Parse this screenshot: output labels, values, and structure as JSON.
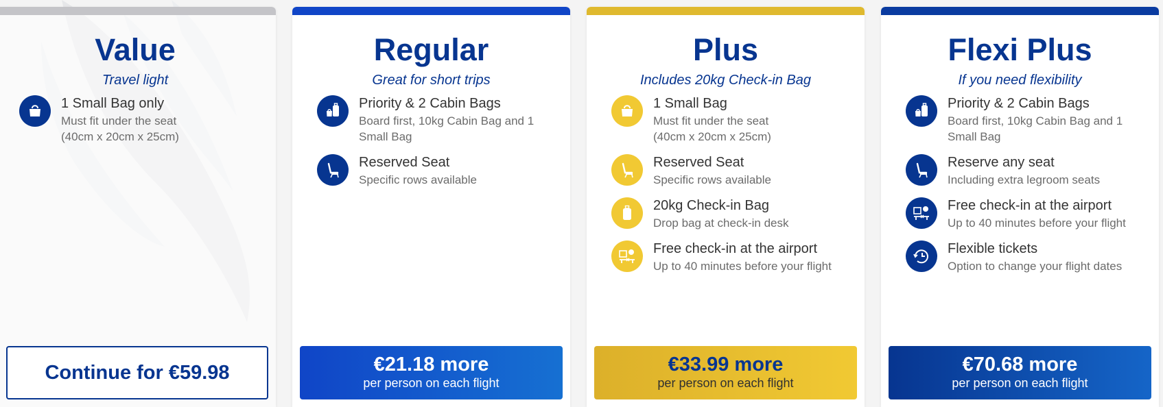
{
  "colors": {
    "brand_navy": "#073590",
    "brand_blue": "#1045c7",
    "brand_yellow": "#f1c933",
    "value_bar": "#c4c4c8",
    "flexi_bar": "#0a3ba0"
  },
  "cards": [
    {
      "title": "Value",
      "subtitle": "Travel light",
      "features": [
        {
          "icon": "small-bag-icon",
          "title": "1 Small Bag only",
          "desc": "Must fit under the seat (40cm x 20cm x 25cm)"
        }
      ],
      "cta": {
        "label": "Continue for €59.98"
      }
    },
    {
      "title": "Regular",
      "subtitle": "Great for short trips",
      "features": [
        {
          "icon": "cabin-bags-icon",
          "title": "Priority & 2 Cabin Bags",
          "desc": "Board first, 10kg Cabin Bag and 1 Small Bag"
        },
        {
          "icon": "seat-icon",
          "title": "Reserved Seat",
          "desc": "Specific rows available"
        }
      ],
      "cta": {
        "price": "€21.18 more",
        "per": "per person on each flight"
      }
    },
    {
      "title": "Plus",
      "subtitle": "Includes 20kg Check-in Bag",
      "features": [
        {
          "icon": "small-bag-icon",
          "title": "1 Small Bag",
          "desc": "Must fit under the seat (40cm x 20cm x 25cm)"
        },
        {
          "icon": "seat-icon",
          "title": "Reserved Seat",
          "desc": "Specific rows available"
        },
        {
          "icon": "suitcase-icon",
          "title": "20kg Check-in Bag",
          "desc": "Drop bag at check-in desk"
        },
        {
          "icon": "checkin-desk-icon",
          "title": "Free check-in at the airport",
          "desc": "Up to 40 minutes before your flight"
        }
      ],
      "cta": {
        "price": "€33.99 more",
        "per": "per person on each flight"
      }
    },
    {
      "title": "Flexi Plus",
      "subtitle": "If you need flexibility",
      "features": [
        {
          "icon": "cabin-bags-icon",
          "title": "Priority & 2 Cabin Bags",
          "desc": "Board first, 10kg Cabin Bag and 1 Small Bag"
        },
        {
          "icon": "seat-icon",
          "title": "Reserve any seat",
          "desc": "Including extra legroom seats"
        },
        {
          "icon": "checkin-desk-icon",
          "title": "Free check-in at the airport",
          "desc": "Up to 40 minutes before your flight"
        },
        {
          "icon": "flexible-ticket-icon",
          "title": "Flexible tickets",
          "desc": "Option to change your flight dates"
        }
      ],
      "cta": {
        "price": "€70.68 more",
        "per": "per person on each flight"
      }
    }
  ]
}
